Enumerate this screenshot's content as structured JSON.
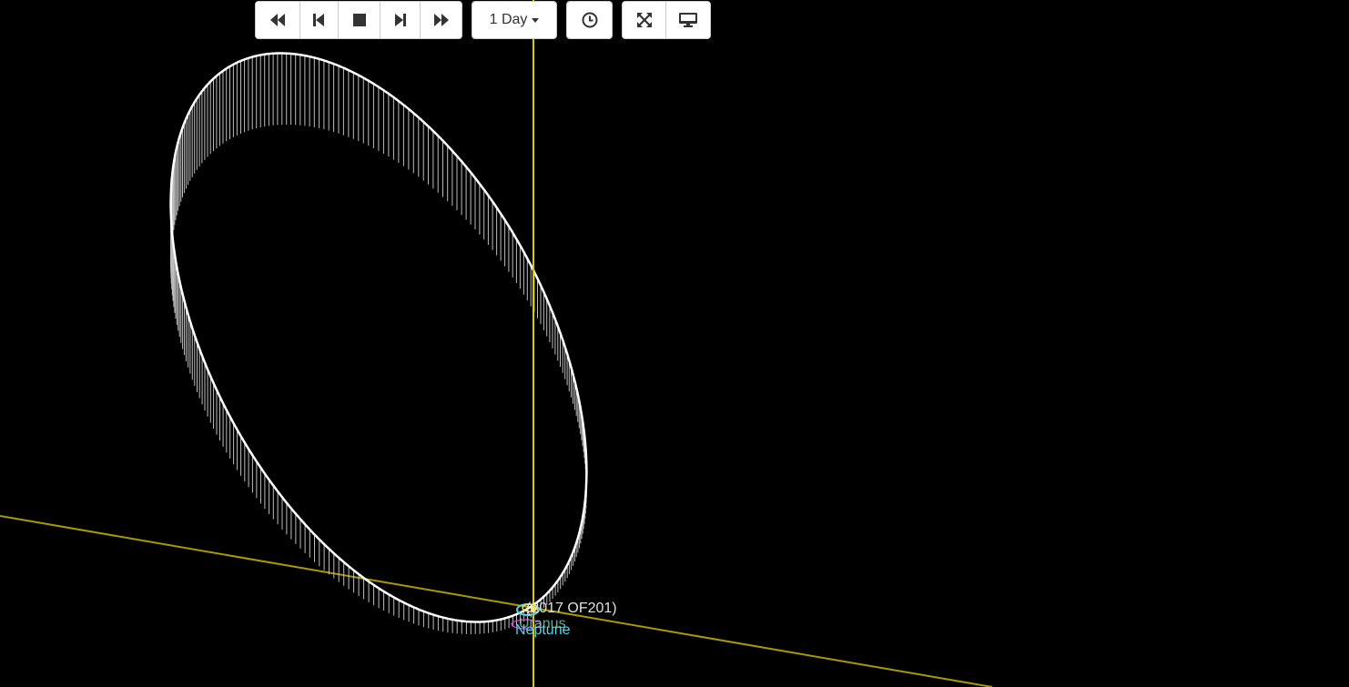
{
  "toolbar": {
    "playback": [
      {
        "name": "fast-backward-button",
        "icon": "fast-backward-icon"
      },
      {
        "name": "step-backward-button",
        "icon": "step-backward-icon"
      },
      {
        "name": "stop-button",
        "icon": "stop-icon"
      },
      {
        "name": "step-forward-button",
        "icon": "step-forward-icon"
      },
      {
        "name": "fast-forward-button",
        "icon": "fast-forward-icon"
      }
    ],
    "step_dropdown": {
      "label": "1 Day"
    },
    "clock_button": {
      "icon": "clock-icon"
    },
    "view_buttons": [
      {
        "name": "fullscreen-button",
        "icon": "fullscreen-icon"
      },
      {
        "name": "display-button",
        "icon": "monitor-icon"
      }
    ]
  },
  "scene": {
    "object_label": "(2017 OF201)",
    "planet_labels": [
      "Neptune",
      "Uranus"
    ],
    "colors": {
      "background": "#000000",
      "axis": "#d8c900",
      "axis_dim": "#9a8f00",
      "orbit": "#ffffff",
      "label": "#e0e0e0",
      "neptune": "#55d6e8",
      "uranus": "#7fd6c0",
      "magenta": "#e040e0"
    }
  }
}
